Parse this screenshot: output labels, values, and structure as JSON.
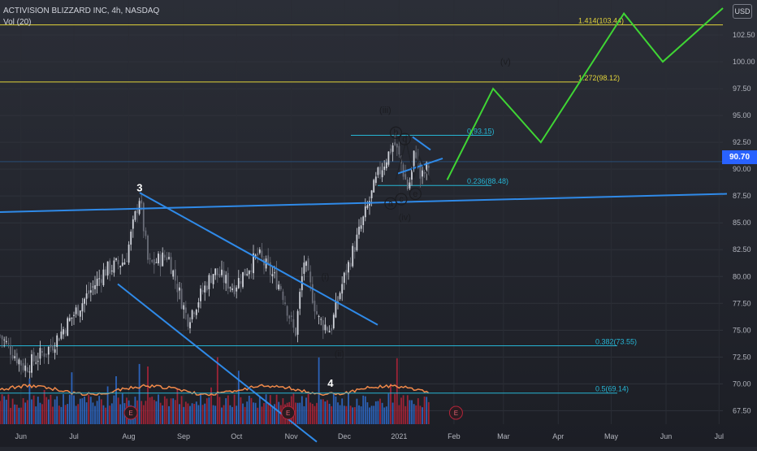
{
  "header": {
    "symbol_line": "ACTIVISION BLIZZARD INC, 4h, NASDAQ",
    "volume_indicator": "Vol (20)",
    "currency": "USD"
  },
  "last_price": {
    "label": "90.70",
    "value": 90.7,
    "color": "#2962ff"
  },
  "colors": {
    "background": "#24272f",
    "up": "#d1d4dc",
    "down": "#6a6d78",
    "trendline": "#2f8ae8",
    "fib_yellow": "#e2d43a",
    "fib_cyan": "#26b5d4",
    "projection": "#3fd534",
    "volume_ma": "#f0894a",
    "vol_up": "#2f6fd2",
    "vol_down": "#b5243a"
  },
  "chart_data": {
    "type": "candlestick",
    "title": "ACTIVISION BLIZZARD INC, 4h, NASDAQ",
    "x_axis_labels": [
      "Jun",
      "Jul",
      "Aug",
      "Sep",
      "Oct",
      "Nov",
      "Dec",
      "2021",
      "Feb",
      "Mar",
      "Apr",
      "May",
      "Jun",
      "Jul"
    ],
    "y_axis_labels": [
      "102.50",
      "100.00",
      "97.50",
      "95.00",
      "92.50",
      "90.00",
      "87.50",
      "85.00",
      "82.50",
      "80.00",
      "77.50",
      "75.00",
      "72.50",
      "70.00",
      "67.50"
    ],
    "y_range": [
      67,
      105
    ],
    "price_path": [
      {
        "date": "2020-05-22",
        "price": 74.5
      },
      {
        "date": "2020-06-05",
        "price": 71.5
      },
      {
        "date": "2020-06-20",
        "price": 73.5
      },
      {
        "date": "2020-07-05",
        "price": 77.0
      },
      {
        "date": "2020-07-20",
        "price": 80.5
      },
      {
        "date": "2020-08-01",
        "price": 81.5
      },
      {
        "date": "2020-08-09",
        "price": 87.5
      },
      {
        "date": "2020-08-14",
        "price": 81.0
      },
      {
        "date": "2020-08-25",
        "price": 82.0
      },
      {
        "date": "2020-09-05",
        "price": 76.0
      },
      {
        "date": "2020-09-20",
        "price": 80.5
      },
      {
        "date": "2020-10-01",
        "price": 79.0
      },
      {
        "date": "2020-10-15",
        "price": 82.0
      },
      {
        "date": "2020-10-28",
        "price": 79.0
      },
      {
        "date": "2020-11-05",
        "price": 74.5
      },
      {
        "date": "2020-11-10",
        "price": 81.5
      },
      {
        "date": "2020-11-18",
        "price": 76.0
      },
      {
        "date": "2020-11-25",
        "price": 75.0
      },
      {
        "date": "2020-12-01",
        "price": 79.0
      },
      {
        "date": "2020-12-08",
        "price": 82.5
      },
      {
        "date": "2020-12-15",
        "price": 86.0
      },
      {
        "date": "2020-12-22",
        "price": 89.5
      },
      {
        "date": "2020-12-31",
        "price": 92.5
      },
      {
        "date": "2021-01-04",
        "price": 90.5
      },
      {
        "date": "2021-01-08",
        "price": 88.0
      },
      {
        "date": "2021-01-12",
        "price": 92.0
      },
      {
        "date": "2021-01-15",
        "price": 89.0
      },
      {
        "date": "2021-01-20",
        "price": 90.5
      }
    ],
    "fib_levels": [
      {
        "label": "1.414(103.44)",
        "price": 103.44,
        "color": "#e2d43a"
      },
      {
        "label": "1.272(98.12)",
        "price": 98.12,
        "color": "#e2d43a"
      },
      {
        "label": "0(93.15)",
        "price": 93.15,
        "color": "#26b5d4"
      },
      {
        "label": "0.236(88.48)",
        "price": 88.48,
        "color": "#26b5d4"
      },
      {
        "label": "0.382(73.55)",
        "price": 73.55,
        "color": "#26b5d4"
      },
      {
        "label": "0.5(69.14)",
        "price": 69.14,
        "color": "#26b5d4"
      }
    ],
    "wave_labels": [
      {
        "text": "3",
        "date": "2020-08-09",
        "price": 88.2
      },
      {
        "text": "4",
        "date": "2020-11-25",
        "price": 70.0
      },
      {
        "text": "(i)",
        "date": "2020-11-22",
        "price": 80.0
      },
      {
        "text": "(ii)",
        "date": "2020-11-30",
        "price": 72.8
      },
      {
        "text": "(iii)",
        "date": "2020-12-26",
        "price": 95.5
      },
      {
        "text": "(iv)",
        "date": "2021-01-06",
        "price": 85.5
      },
      {
        "text": "(v)",
        "date": "2021-03-04",
        "price": 100.0
      },
      {
        "text": "a",
        "date": "2020-12-29",
        "price": 86.8
      },
      {
        "text": "b",
        "date": "2021-01-01",
        "price": 93.4
      },
      {
        "text": "c",
        "date": "2021-01-04",
        "price": 87.2
      },
      {
        "text": "d",
        "date": "2021-01-06",
        "price": 92.8
      },
      {
        "text": "e",
        "date": "2021-01-12",
        "price": 87.7
      }
    ],
    "projection_path": [
      {
        "date": "2021-01-30",
        "price": 89.0
      },
      {
        "date": "2021-02-25",
        "price": 97.5
      },
      {
        "date": "2021-03-24",
        "price": 92.5
      },
      {
        "date": "2021-05-10",
        "price": 104.5
      },
      {
        "date": "2021-06-01",
        "price": 100.0
      },
      {
        "date": "2021-07-05",
        "price": 105.0
      }
    ],
    "earnings_markers": [
      {
        "label": "E",
        "date": "2020-08-04"
      },
      {
        "label": "E",
        "date": "2020-11-01"
      },
      {
        "label": "E",
        "date": "2021-02-04"
      }
    ],
    "volume_ma_period": 20
  }
}
